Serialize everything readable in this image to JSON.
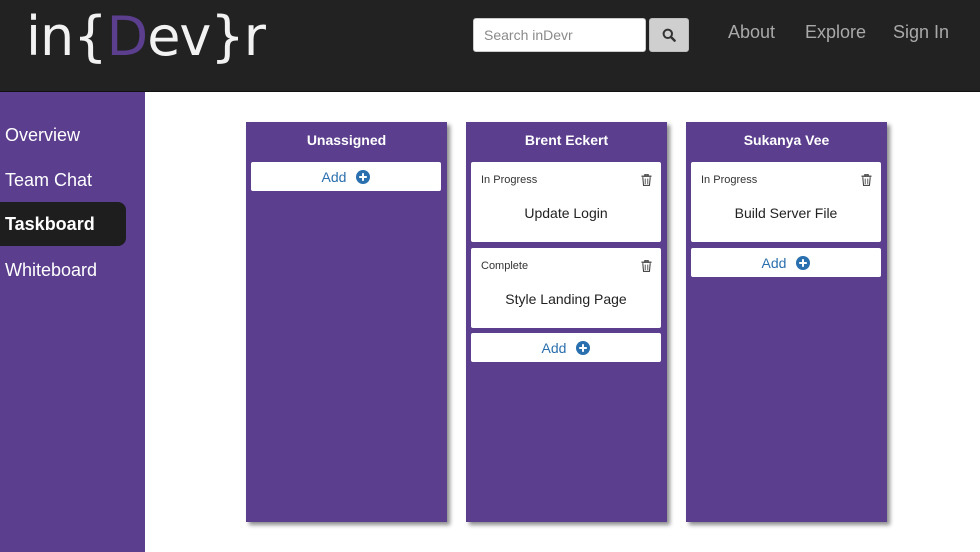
{
  "header": {
    "logo": {
      "prefix": "in{",
      "accent": "D",
      "suffix": "ev}r"
    },
    "search": {
      "placeholder": "Search inDevr",
      "value": ""
    },
    "nav": [
      {
        "label": "About"
      },
      {
        "label": "Explore"
      },
      {
        "label": "Sign In"
      }
    ]
  },
  "sidebar": {
    "items": [
      {
        "label": "Overview",
        "active": false
      },
      {
        "label": "Team Chat",
        "active": false
      },
      {
        "label": "Taskboard",
        "active": true
      },
      {
        "label": "Whiteboard",
        "active": false
      }
    ]
  },
  "board": {
    "columns": [
      {
        "title": "Unassigned",
        "tasks": [],
        "add_label": "Add"
      },
      {
        "title": "Brent Eckert",
        "tasks": [
          {
            "status": "In Progress",
            "title": "Update Login"
          },
          {
            "status": "Complete",
            "title": "Style Landing Page"
          }
        ],
        "add_label": "Add"
      },
      {
        "title": "Sukanya Vee",
        "tasks": [
          {
            "status": "In Progress",
            "title": "Build Server File"
          }
        ],
        "add_label": "Add"
      }
    ]
  },
  "icons": {
    "search": "search-icon",
    "trash": "trash-icon",
    "add": "plus-circle-icon"
  },
  "colors": {
    "header_bg": "#222222",
    "brand_purple": "#5b3e8e",
    "link_blue": "#2a6fae",
    "active_nav_bg": "#1e1e1e"
  }
}
